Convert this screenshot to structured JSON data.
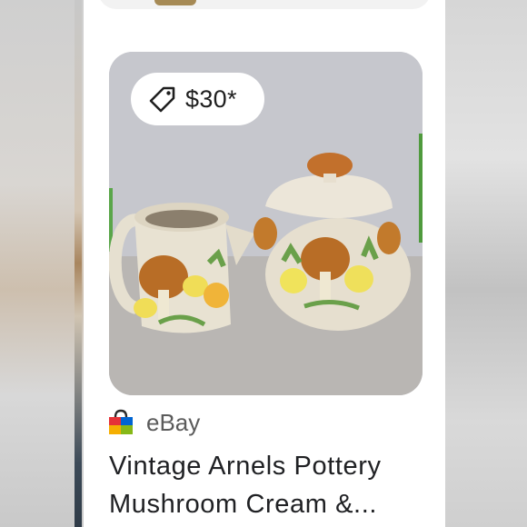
{
  "listing": {
    "price": "$30*",
    "source": "eBay",
    "title_line1": "Vintage Arnels Pottery",
    "title_line2": "Mushroom Cream &..."
  },
  "icons": {
    "price_tag": "tag-icon",
    "source_logo": "ebay-shopping-bag-icon"
  },
  "colors": {
    "card_background": "#ffffff",
    "badge_background": "#ffffff",
    "title_text": "#202124",
    "source_text": "#5b5b5b"
  }
}
